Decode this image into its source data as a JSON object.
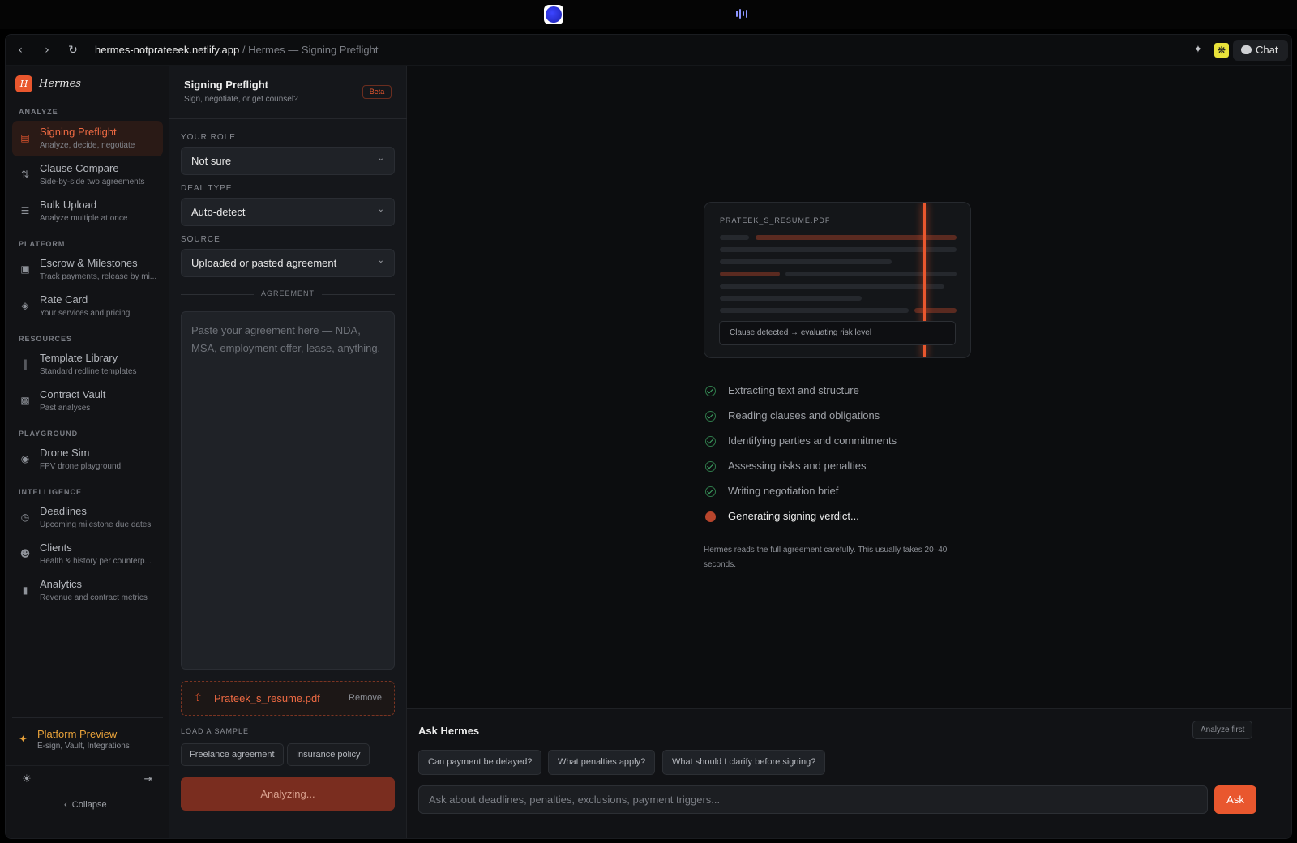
{
  "browser": {
    "url_domain": "hermes-notprateeek.netlify.app",
    "url_separator": " / ",
    "page_title": "Hermes — Signing Preflight",
    "chat_label": "Chat"
  },
  "sidebar": {
    "brand": "Hermes",
    "brand_logo": "H",
    "sections": {
      "analyze": "ANALYZE",
      "platform": "PLATFORM",
      "resources": "RESOURCES",
      "playground": "PLAYGROUND",
      "intelligence": "INTELLIGENCE"
    },
    "items": [
      {
        "label": "Signing Preflight",
        "sub": "Analyze, decide, negotiate",
        "icon": "document-icon"
      },
      {
        "label": "Clause Compare",
        "sub": "Side-by-side two agreements",
        "icon": "compare-icon"
      },
      {
        "label": "Bulk Upload",
        "sub": "Analyze multiple at once",
        "icon": "layers-icon"
      },
      {
        "label": "Escrow & Milestones",
        "sub": "Track payments, release by mi...",
        "icon": "lock-icon"
      },
      {
        "label": "Rate Card",
        "sub": "Your services and pricing",
        "icon": "tag-icon"
      },
      {
        "label": "Template Library",
        "sub": "Standard redline templates",
        "icon": "library-icon"
      },
      {
        "label": "Contract Vault",
        "sub": "Past analyses",
        "icon": "archive-icon"
      },
      {
        "label": "Drone Sim",
        "sub": "FPV drone playground",
        "icon": "gamepad-icon"
      },
      {
        "label": "Deadlines",
        "sub": "Upcoming milestone due dates",
        "icon": "calendar-clock-icon"
      },
      {
        "label": "Clients",
        "sub": "Health & history per counterp...",
        "icon": "users-icon"
      },
      {
        "label": "Analytics",
        "sub": "Revenue and contract metrics",
        "icon": "bar-chart-icon"
      }
    ],
    "preview": {
      "label": "Platform Preview",
      "sub": "E-sign, Vault, Integrations"
    },
    "collapse": "Collapse"
  },
  "form": {
    "title": "Signing Preflight",
    "subtitle": "Sign, negotiate, or get counsel?",
    "badge": "Beta",
    "role_label": "YOUR ROLE",
    "role_value": "Not sure",
    "deal_label": "DEAL TYPE",
    "deal_value": "Auto-detect",
    "source_label": "SOURCE",
    "source_value": "Uploaded or pasted agreement",
    "agreement_label": "AGREEMENT",
    "agreement_placeholder": "Paste your agreement here — NDA, MSA, employment offer, lease, anything.",
    "file_name": "Prateek_s_resume.pdf",
    "remove_label": "Remove",
    "sample_label": "LOAD A SAMPLE",
    "samples": [
      "Freelance agreement",
      "Insurance policy"
    ],
    "analyze_label": "Analyzing..."
  },
  "analysis": {
    "doc_name": "PRATEEK_S_RESUME.PDF",
    "clause_status": "Clause detected → evaluating risk level",
    "steps": [
      {
        "label": "Extracting text and structure",
        "state": "done"
      },
      {
        "label": "Reading clauses and obligations",
        "state": "done"
      },
      {
        "label": "Identifying parties and commitments",
        "state": "done"
      },
      {
        "label": "Assessing risks and penalties",
        "state": "done"
      },
      {
        "label": "Writing negotiation brief",
        "state": "done"
      },
      {
        "label": "Generating signing verdict...",
        "state": "current"
      }
    ],
    "note": "Hermes reads the full agreement carefully. This usually takes 20–40 seconds."
  },
  "ask": {
    "title": "Ask Hermes",
    "status": "Analyze first",
    "questions": [
      "Can payment be delayed?",
      "What penalties apply?",
      "What should I clarify before signing?"
    ],
    "placeholder": "Ask about deadlines, penalties, exclusions, payment triggers...",
    "button": "Ask"
  },
  "colors": {
    "accent": "#e9572e",
    "success": "#3fa566",
    "warning": "#e8a23a"
  }
}
